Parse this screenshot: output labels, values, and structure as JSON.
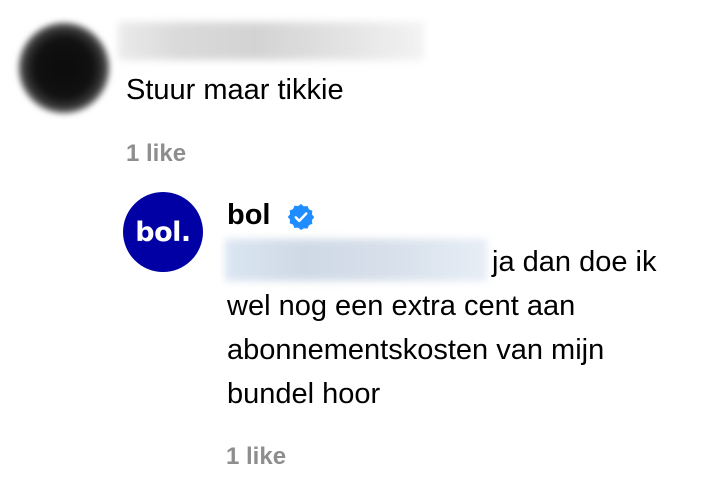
{
  "comment": {
    "text": "Stuur maar tikkie",
    "likes": "1 like"
  },
  "reply": {
    "author": "bol",
    "avatar_text": "bol.",
    "verified_icon": "verified-badge-icon",
    "lines": [
      "ja dan doe ik",
      "wel nog een extra cent aan",
      "abonnementskosten van mijn",
      "bundel hoor"
    ],
    "likes": "1 like"
  },
  "colors": {
    "brand": "#0000a4",
    "verified": "#1f8cff",
    "meta": "#8e8e8e"
  }
}
